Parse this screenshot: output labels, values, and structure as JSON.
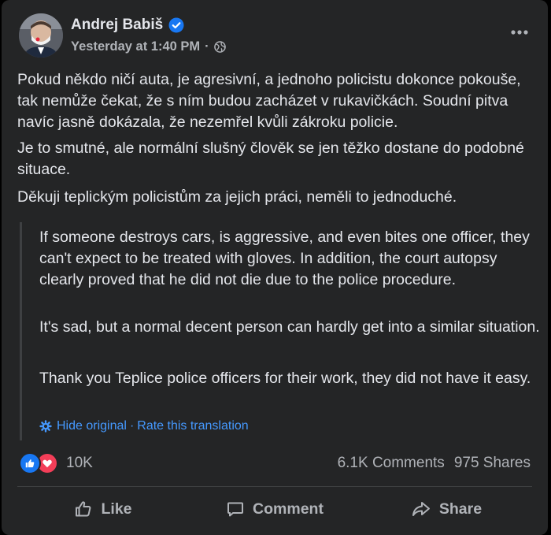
{
  "post": {
    "author": "Andrej Babiš",
    "timestamp": "Yesterday at 1:40 PM",
    "meta_separator": "·",
    "audience_icon": "globe-icon",
    "verified_icon": "verified-badge-icon",
    "more_icon": "more-options-icon",
    "paragraphs": [
      "Pokud někdo ničí auta, je agresivní, a jednoho policistu dokonce pokouše, tak nemůže čekat, že s ním budou zacházet v rukavičkách. Soudní pitva navíc jasně dokázala, že nezemřel kvůli zákroku policie.",
      "Je to smutné, ale normální slušný člověk se jen těžko dostane do podobné situace.",
      "Děkuji teplickým policistům za jejich práci, neměli to jednoduché."
    ],
    "translation": {
      "paragraphs": [
        "If someone destroys cars, is aggressive, and even bites one officer, they can't expect to be treated with gloves. In addition, the court autopsy clearly proved that he did not die due to the police procedure.",
        "It's sad, but a normal decent person can hardly get into a similar situation.",
        "Thank you Teplice police officers for their work, they did not have it easy."
      ],
      "hide_original": "Hide original",
      "separator": "·",
      "rate": "Rate this translation",
      "icon": "gear-icon"
    },
    "reactions": {
      "count": "10K",
      "icons": [
        "like-reaction-icon",
        "love-reaction-icon"
      ]
    },
    "comments": "6.1K Comments",
    "shares": "975 Shares",
    "actions": {
      "like": "Like",
      "comment": "Comment",
      "share": "Share"
    },
    "colors": {
      "background": "#242526",
      "text": "#e4e6eb",
      "secondary": "#b0b3b8",
      "link": "#4599ff",
      "like_blue": "#1877f2",
      "love_red": "#f33e58"
    }
  }
}
